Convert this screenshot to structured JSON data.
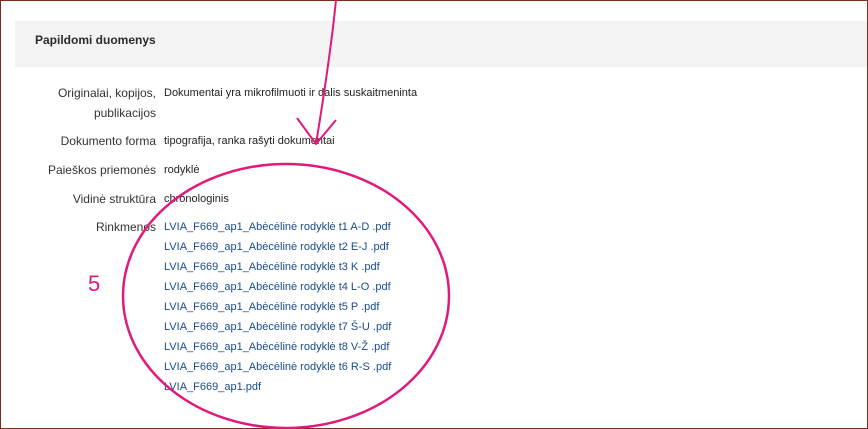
{
  "panel": {
    "title": "Papildomi duomenys"
  },
  "fields": [
    {
      "label_line1": "Originalai, kopijos,",
      "label_line2": "publikacijos",
      "value": "Dokumentai yra mikrofilmuoti ir dalis suskaitmeninta"
    },
    {
      "label": "Dokumento forma",
      "value": "tipografija, ranka rašyti dokumentai"
    },
    {
      "label": "Paieškos priemonės",
      "value": "rodyklė"
    },
    {
      "label": "Vidinė struktūra",
      "value": "chronologinis"
    },
    {
      "label": "Rinkmenos"
    }
  ],
  "files": [
    "LVIA_F669_ap1_Abėcėlinė rodyklė t1 A-D .pdf",
    "LVIA_F669_ap1_Abėcėlinė rodyklė t2 E-J .pdf",
    "LVIA_F669_ap1_Abėcėlinė rodyklė t3 K .pdf",
    "LVIA_F669_ap1_Abėcėlinė rodyklė t4 L-O .pdf",
    "LVIA_F669_ap1_Abėcėlinė rodyklė t5 P .pdf",
    "LVIA_F669_ap1_Abėcėlinė rodyklė t7 Š-U .pdf",
    "LVIA_F669_ap1_Abėcėlinė rodyklė t8 V-Ž .pdf",
    "LVIA_F669_ap1_Abėcėlinė rodyklė t6 R-S .pdf",
    "LVIA_F669_ap1.pdf"
  ],
  "annotation": {
    "number": "5",
    "color": "#e0197a"
  }
}
